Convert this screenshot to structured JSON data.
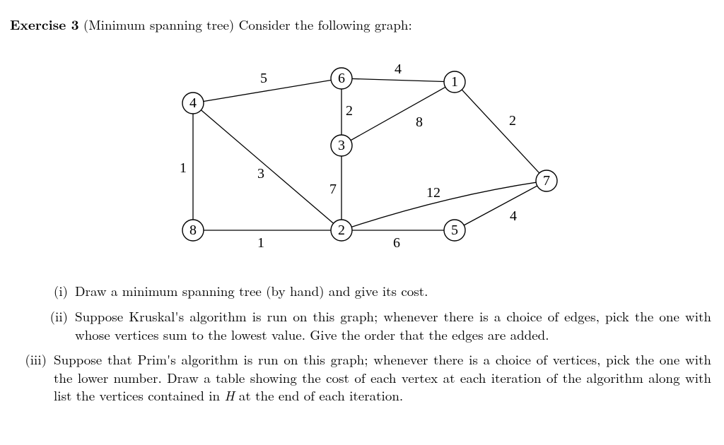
{
  "header": {
    "title_bold": "Exercise 3",
    "title_paren": "(Minimum spanning tree)",
    "title_rest": "Consider the following graph:"
  },
  "graph": {
    "nodes": {
      "n1": "1",
      "n2": "2",
      "n3": "3",
      "n4": "4",
      "n5": "5",
      "n6": "6",
      "n7": "7",
      "n8": "8"
    },
    "weights": {
      "e46": "5",
      "e61": "4",
      "e63": "2",
      "e17": "2",
      "e31": "8",
      "e48": "1",
      "e42": "3",
      "e32": "7",
      "e27": "12",
      "e57": "4",
      "e82": "1",
      "e25": "6"
    }
  },
  "questions": {
    "q1_num": "(i)",
    "q1_txt": "Draw a minimum spanning tree (by hand) and give its cost.",
    "q2_num": "(ii)",
    "q2_txt": "Suppose Kruskal's algorithm is run on this graph; whenever there is a choice of edges, pick the one with whose vertices sum to the lowest value. Give the order that the edges are added.",
    "q3_num": "(iii)",
    "q3_txt_a": "Suppose that Prim's algorithm is run on this graph; whenever there is a choice of vertices, pick the one with the lower number. Draw a table showing the cost of each vertex at each iteration of the algorithm along with list the vertices contained in ",
    "q3_var": "H",
    "q3_txt_b": " at the end of each iteration."
  },
  "chart_data": {
    "type": "graph",
    "title": "Weighted undirected graph for minimum spanning tree exercise",
    "nodes": [
      1,
      2,
      3,
      4,
      5,
      6,
      7,
      8
    ],
    "edges": [
      {
        "u": 4,
        "v": 6,
        "w": 5
      },
      {
        "u": 6,
        "v": 1,
        "w": 4
      },
      {
        "u": 6,
        "v": 3,
        "w": 2
      },
      {
        "u": 1,
        "v": 7,
        "w": 2
      },
      {
        "u": 3,
        "v": 1,
        "w": 8
      },
      {
        "u": 4,
        "v": 8,
        "w": 1
      },
      {
        "u": 4,
        "v": 2,
        "w": 3
      },
      {
        "u": 3,
        "v": 2,
        "w": 7
      },
      {
        "u": 2,
        "v": 7,
        "w": 12
      },
      {
        "u": 5,
        "v": 7,
        "w": 4
      },
      {
        "u": 8,
        "v": 2,
        "w": 1
      },
      {
        "u": 2,
        "v": 5,
        "w": 6
      }
    ]
  }
}
